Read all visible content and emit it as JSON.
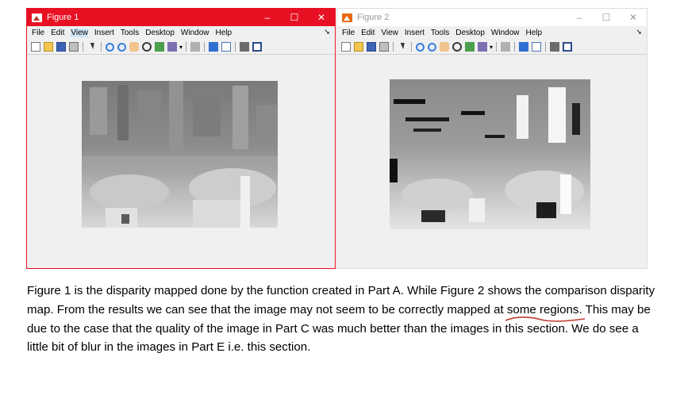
{
  "figure1": {
    "title": "Figure 1",
    "window_controls": {
      "minimize": "–",
      "maximize": "☐",
      "close": "✕"
    },
    "menu": [
      "File",
      "Edit",
      "View",
      "Insert",
      "Tools",
      "Desktop",
      "Window",
      "Help"
    ],
    "menu_arrow": "➘",
    "image_desc": "disparity-map-custom-function"
  },
  "figure2": {
    "title": "Figure 2",
    "window_controls": {
      "minimize": "–",
      "maximize": "☐",
      "close": "✕"
    },
    "menu": [
      "File",
      "Edit",
      "View",
      "Insert",
      "Tools",
      "Desktop",
      "Window",
      "Help"
    ],
    "menu_arrow": "➘",
    "image_desc": "disparity-map-comparison"
  },
  "toolbar_icons": [
    "new-figure-icon",
    "open-file-icon",
    "save-icon",
    "print-icon",
    "pointer-icon",
    "zoom-in-icon",
    "zoom-out-icon",
    "pan-icon",
    "rotate-3d-icon",
    "data-cursor-icon",
    "brush-icon",
    "link-icon",
    "colorbar-icon",
    "legend-icon",
    "hide-plot-tools-icon",
    "show-plot-tools-icon"
  ],
  "colors": {
    "active_title": "#e81123",
    "inactive_title": "#ffffff",
    "figure_bg": "#f0f0f0"
  },
  "caption": {
    "part1": "Figure 1 is the disparity mapped done by the function created in Part A. While Figure 2 shows the comparison disparity map. From the results we can see that the image may not seem to be correctly mapped at ",
    "underlined": "some regions",
    "part2": ". This may be due to the case that the quality of the image in Part C was much better than the images in this section. We do see a little bit of blur in the images in Part E i.e. this section."
  }
}
